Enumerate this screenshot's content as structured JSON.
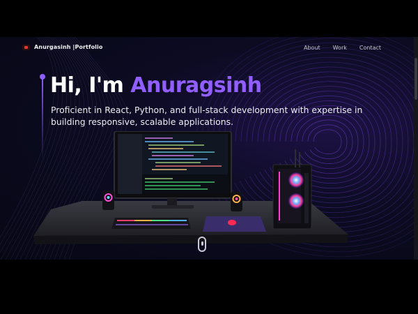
{
  "brand": {
    "name": "Anurgasinh |Portfolio"
  },
  "nav": {
    "items": [
      "About",
      "Work",
      "Contact"
    ]
  },
  "hero": {
    "greeting": "Hi, I'm",
    "name": "Anuragsinh",
    "subtitle": "Proficient in React, Python, and full-stack development with expertise in building responsive, scalable applications."
  },
  "colors": {
    "accent": "#915eff",
    "background": "#070714",
    "text": "#ffffff"
  },
  "icons": {
    "logo": "logo-icon",
    "scroll": "mouse-scroll-icon"
  }
}
